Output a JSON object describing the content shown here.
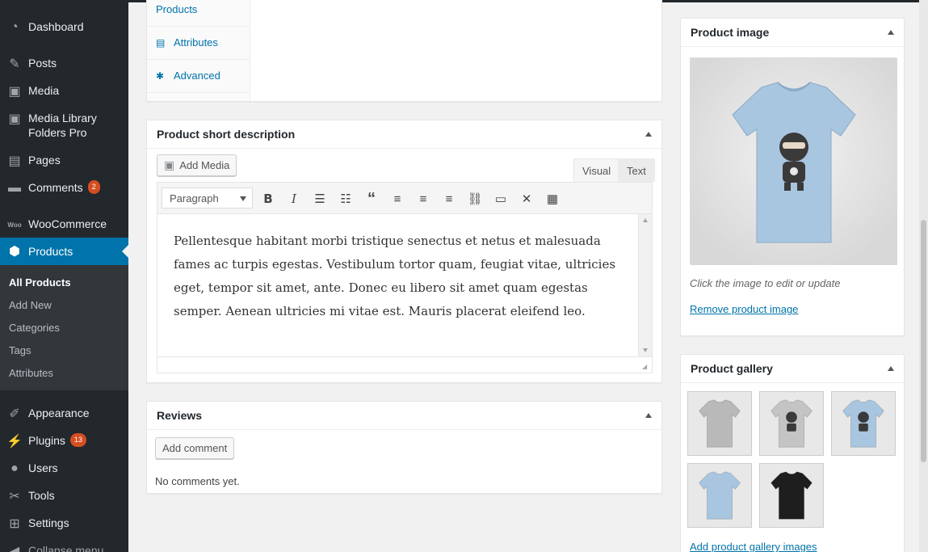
{
  "sidebar": {
    "dashboard": "Dashboard",
    "posts": "Posts",
    "media": "Media",
    "media_library_folders": "Media Library Folders Pro",
    "pages": "Pages",
    "comments": "Comments",
    "comments_count": "2",
    "woocommerce": "WooCommerce",
    "products": "Products",
    "submenu": {
      "all_products": "All Products",
      "add_new": "Add New",
      "categories": "Categories",
      "tags": "Tags",
      "attributes": "Attributes"
    },
    "appearance": "Appearance",
    "plugins": "Plugins",
    "plugins_count": "13",
    "users": "Users",
    "tools": "Tools",
    "settings": "Settings",
    "collapse": "Collapse menu"
  },
  "product_data_tabs": {
    "products": "Products",
    "attributes": "Attributes",
    "advanced": "Advanced"
  },
  "short_description": {
    "title": "Product short description",
    "add_media": "Add Media",
    "tab_visual": "Visual",
    "tab_text": "Text",
    "format": "Paragraph",
    "content": "Pellentesque habitant morbi tristique senectus et netus et malesuada fames ac turpis egestas. Vestibulum tortor quam, feugiat vitae, ultricies eget, tempor sit amet, ante. Donec eu libero sit amet quam egestas semper. Aenean ultricies mi vitae est. Mauris placerat eleifend leo."
  },
  "reviews": {
    "title": "Reviews",
    "add_comment": "Add comment",
    "empty": "No comments yet."
  },
  "product_image": {
    "title": "Product image",
    "hint": "Click the image to edit or update",
    "remove": "Remove product image",
    "shirt_color": "#a9c6e0"
  },
  "product_gallery": {
    "title": "Product gallery",
    "add": "Add product gallery images",
    "thumbs": [
      {
        "color": "#b9b9b9",
        "logo": false
      },
      {
        "color": "#c4c4c4",
        "logo": true
      },
      {
        "color": "#a9c6e0",
        "logo": true
      },
      {
        "color": "#a9c6e0",
        "logo": false
      },
      {
        "color": "#1e1e1e",
        "logo": false
      }
    ]
  },
  "colors": {
    "sidebar_bg": "#23282d",
    "accent": "#0073aa",
    "badge": "#d54e21"
  }
}
